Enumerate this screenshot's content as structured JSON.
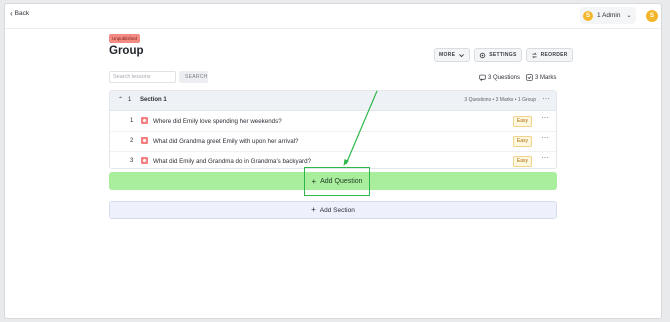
{
  "topbar": {
    "back_label": "Back",
    "admin_label": "1 Admin",
    "admin_initial": "S",
    "avatar_initial": "S"
  },
  "header": {
    "badge": "Unpublished",
    "title": "Group",
    "actions": {
      "more": "MORE",
      "settings": "SETTINGS",
      "reorder": "REORDER"
    }
  },
  "search": {
    "placeholder": "Search lessons",
    "button": "SEARCH"
  },
  "stats": {
    "questions": "3 Questions",
    "marks": "3 Marks"
  },
  "section": {
    "number": "1",
    "title": "Section 1",
    "meta": "3 Questions • 3 Marks • 1 Group",
    "questions": [
      {
        "number": "1",
        "text": "Where did Emily love spending her weekends?",
        "difficulty": "Easy"
      },
      {
        "number": "2",
        "text": "What did Grandma greet Emily with upon her arrival?",
        "difficulty": "Easy"
      },
      {
        "number": "3",
        "text": "What did Emily and Grandma do in Grandma's backyard?",
        "difficulty": "Easy"
      }
    ]
  },
  "add_question_label": "Add Question",
  "add_section_label": "Add Section",
  "colors": {
    "highlight_bar": "#a8ee9d",
    "highlight_border": "#2fb84a",
    "badge": "#f28b82",
    "accent_coin": "#f4b62a"
  },
  "icons": [
    "chevron-left-icon",
    "coin-icon",
    "chevron-down-icon",
    "gear-icon",
    "reorder-icon",
    "questions-icon",
    "marks-checkbox-icon",
    "chevron-up-icon",
    "more-icon",
    "question-type-icon",
    "plus-icon",
    "annotation-arrow"
  ]
}
